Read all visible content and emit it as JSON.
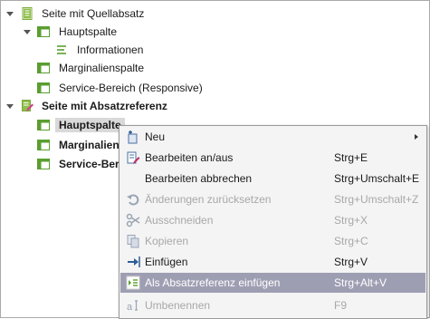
{
  "tree": {
    "items": [
      {
        "label": "Seite mit Quellabsatz"
      },
      {
        "label": "Hauptspalte"
      },
      {
        "label": "Informationen"
      },
      {
        "label": "Marginalienspalte"
      },
      {
        "label": "Service-Bereich (Responsive)"
      },
      {
        "label": "Seite mit Absatzreferenz"
      },
      {
        "label": "Hauptspalte"
      },
      {
        "label": "Marginaliens"
      },
      {
        "label": "Service-Berei"
      }
    ]
  },
  "context_menu": {
    "items": [
      {
        "label": "Neu",
        "shortcut": ""
      },
      {
        "label": "Bearbeiten an/aus",
        "shortcut": "Strg+E"
      },
      {
        "label": "Bearbeiten abbrechen",
        "shortcut": "Strg+Umschalt+E"
      },
      {
        "label": "Änderungen zurücksetzen",
        "shortcut": "Strg+Umschalt+Z"
      },
      {
        "label": "Ausschneiden",
        "shortcut": "Strg+X"
      },
      {
        "label": "Kopieren",
        "shortcut": "Strg+C"
      },
      {
        "label": "Einfügen",
        "shortcut": "Strg+V"
      },
      {
        "label": "Als Absatzreferenz einfügen",
        "shortcut": "Strg+Alt+V"
      },
      {
        "label": "Umbenennen",
        "shortcut": "F9"
      }
    ]
  },
  "colors": {
    "highlight": "#9e9eb3",
    "disabled_text": "#a8a8a8",
    "section_icon_green": "#5a9e2f",
    "edit_pencil_pink": "#d0408a",
    "selection_bg": "#d9d9d9"
  },
  "icons": {
    "page": "page-icon",
    "section": "section-icon",
    "paragraph": "paragraph-icon",
    "page_edit": "page-edit-icon"
  }
}
